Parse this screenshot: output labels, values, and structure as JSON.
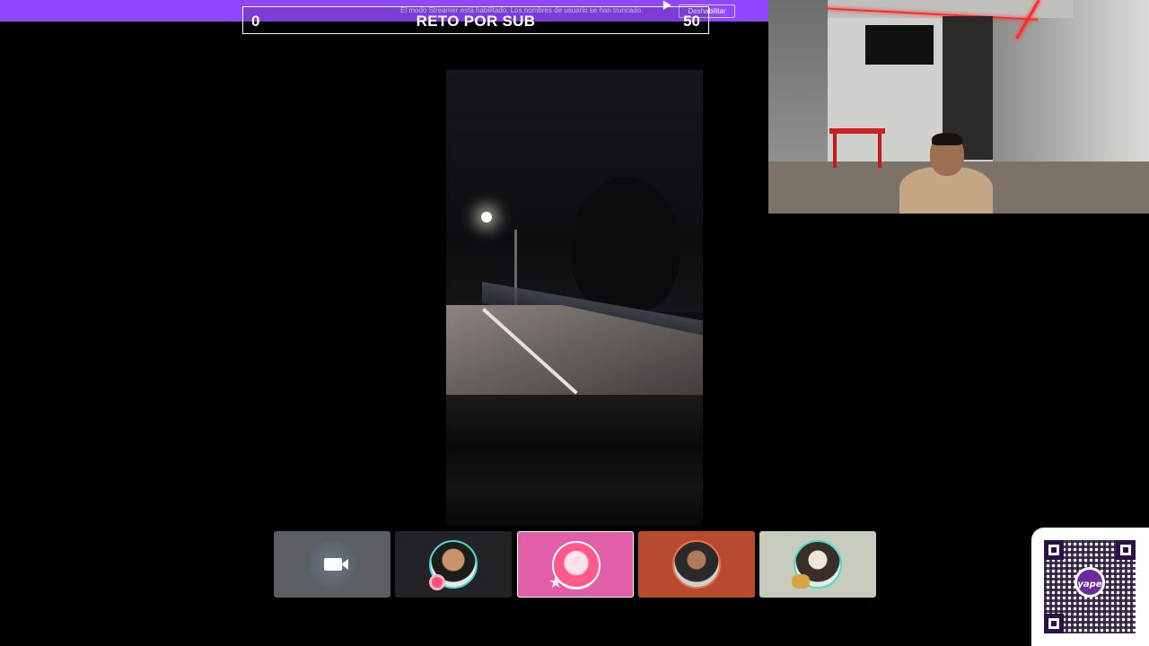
{
  "topbar": {
    "streamer_notice": "El modo Streamer está habilitado. Los nombres de usuario se han truncado.",
    "disable_label": "Deshabilitar",
    "color": "#9147ff"
  },
  "goal": {
    "current": "0",
    "title": "RETO POR SUB",
    "target": "50"
  },
  "participants": [
    {
      "type": "camera-off",
      "accent": "#5b5e62"
    },
    {
      "type": "avatar",
      "accent": "#232226"
    },
    {
      "type": "avatar",
      "accent": "#e05fa8"
    },
    {
      "type": "avatar",
      "accent": "#b84a2e"
    },
    {
      "type": "avatar",
      "accent": "#c5cbbd"
    }
  ],
  "qr": {
    "logo_text": "yape",
    "brand_color": "#6a2c9c"
  },
  "icons": [
    "camera-icon",
    "qr-code-icon",
    "cursor-icon"
  ]
}
